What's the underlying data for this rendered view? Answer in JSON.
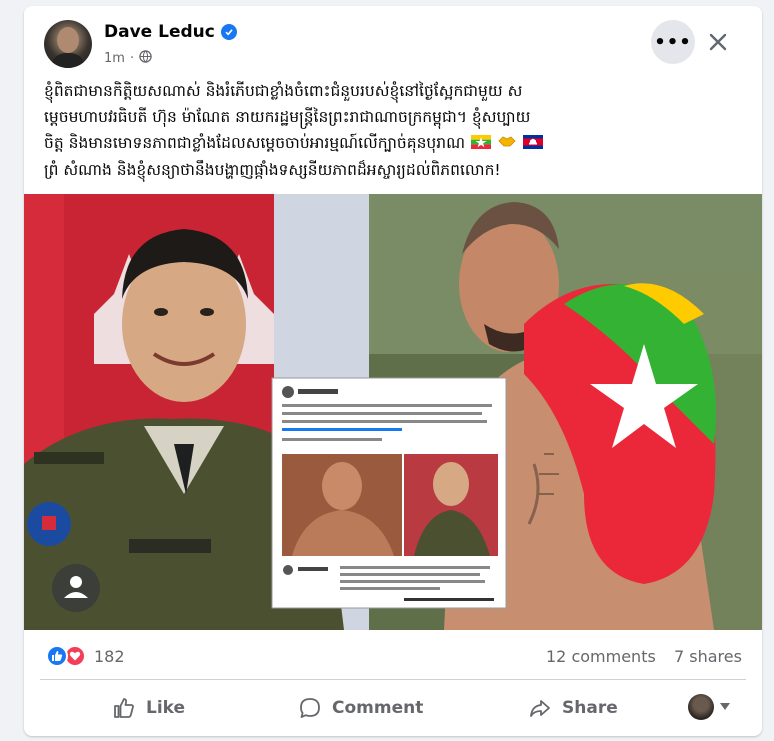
{
  "post": {
    "author": "Dave Leduc",
    "time": "1m",
    "text_line1": "ខ្ញុំពិតជាមានកិត្តិយសណាស់ និងរំភើបជាខ្លាំងចំពោះជំនួបរបស់ខ្ញុំនៅថ្ងៃស្អែកជាមួយ ស",
    "text_line2": "ម្តេចមហាបវរធិបតី ហ៊ុន ម៉ាណែត នាយករដ្ឋមន្ត្រីនៃព្រះរាជាណាចក្រកម្ពុជា។ ខ្ញុំសប្បាយ",
    "text_line3": "ចិត្ត និងមានមោទនភាពជាខ្លាំងដែលសម្តេចចាប់អារម្មណ៍លើក្បាច់គុនបុរាណ",
    "text_line4": "ព្រំ សំណាង និងខ្ញុំសន្យាថានឹងបង្ហាញផ្កាំងទស្សនីយភាពដ៏អស្ចារ្យដល់ពិភពលោក!"
  },
  "icons": {
    "verified": "verified-badge-icon",
    "globe": "globe-icon",
    "more": "more-horizontal-icon",
    "close": "close-icon",
    "like_reaction": "like-reaction-icon",
    "love_reaction": "love-reaction-icon"
  },
  "stats": {
    "reactions_count": "182",
    "comments": "12 comments",
    "shares": "7 shares"
  },
  "actions": {
    "like": "Like",
    "comment": "Comment",
    "share": "Share"
  },
  "colors": {
    "accent": "#1877f2",
    "love": "#f33e58",
    "muted_text": "#65676b"
  }
}
